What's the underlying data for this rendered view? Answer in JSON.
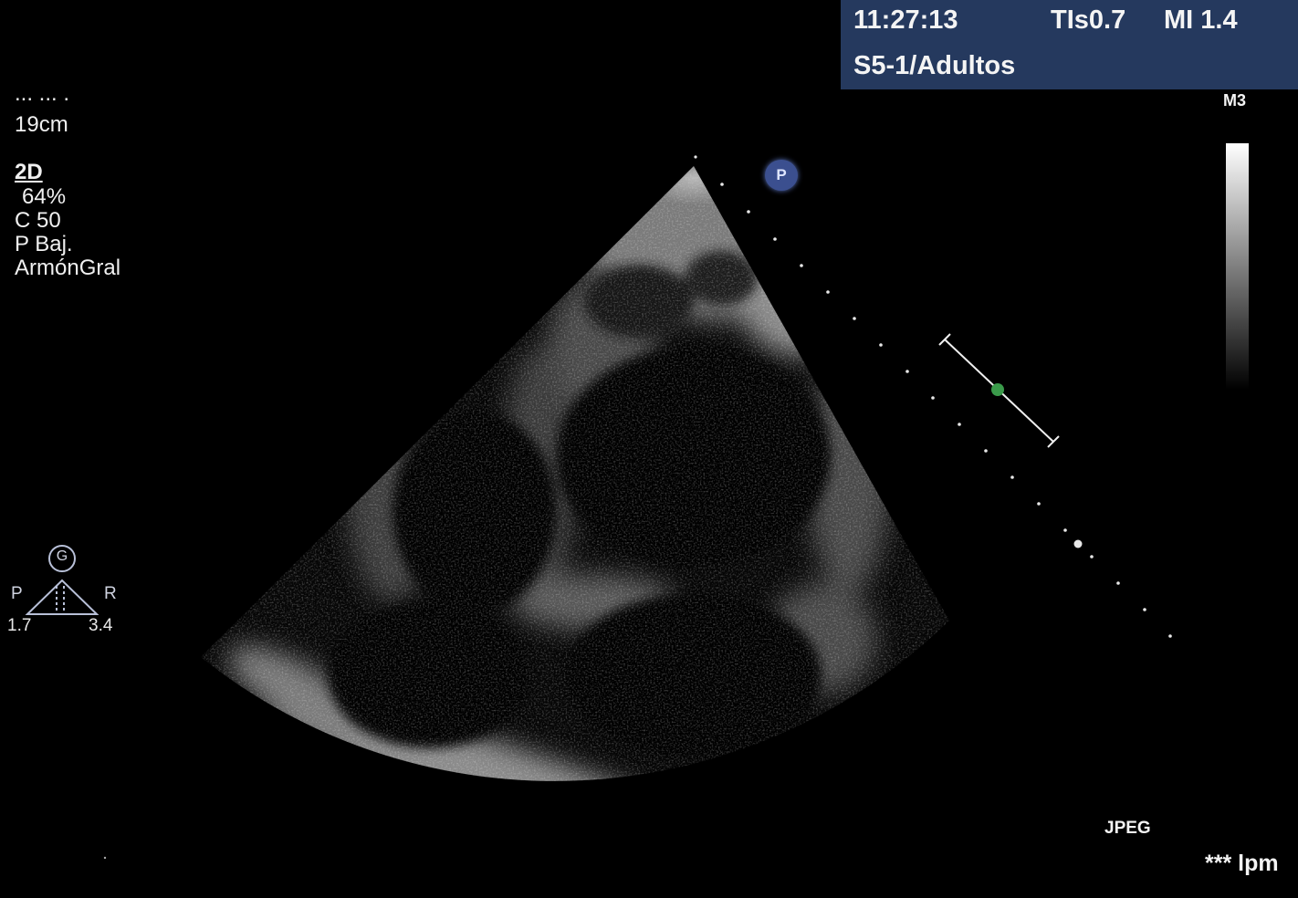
{
  "header": {
    "time": "11:27:13",
    "tis": "TIs0.7",
    "mi": "MI 1.4",
    "probe_preset": "S5-1/Adultos"
  },
  "grayscale_map": "M3",
  "left_panel": {
    "cut_off_line": "... ... .",
    "depth": "19cm",
    "mode": "2D",
    "gain": "64%",
    "compression": "C 50",
    "power": "P Baj.",
    "harmonics": "ArmónGral"
  },
  "orientation": {
    "marker": "G",
    "left_label": "P",
    "right_label": "R",
    "left_value": "1.7",
    "right_value": "3.4"
  },
  "probe_marker": "P",
  "format": "JPEG",
  "heart_rate": "*** lpm",
  "colors": {
    "header_bg": "#25395e",
    "probe_marker": "#3b4f8f",
    "focus_dot": "#3a9a4a"
  }
}
